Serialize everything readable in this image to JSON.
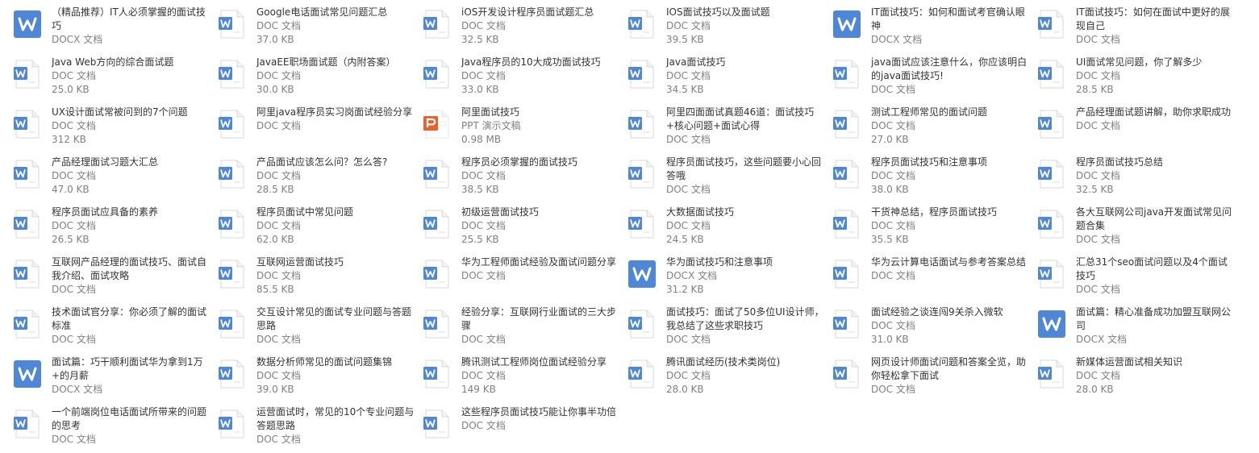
{
  "type_labels": {
    "doc": "DOC 文档",
    "docx": "DOCX 文档",
    "ppt": "PPT 演示文稿"
  },
  "icons": {
    "doc-icon": {
      "fill": "#ffffff",
      "stroke": "#d9d9d9",
      "accent": "#4e86d8"
    },
    "docx-icon": {
      "fill": "#4e86d8",
      "stroke": "#4e86d8",
      "accent": "#ffffff"
    },
    "ppt-icon": {
      "fill": "#ffffff",
      "stroke": "#e8e8e8",
      "accent": "#e8622e"
    }
  },
  "files": [
    {
      "name": "（精品推荐）IT人必须掌握的面试技巧",
      "kind": "docx",
      "size": ""
    },
    {
      "name": "Google电话面试常见问题汇总",
      "kind": "doc",
      "size": "37.0 KB"
    },
    {
      "name": "iOS开发设计程序员面试题汇总",
      "kind": "doc",
      "size": "32.5 KB"
    },
    {
      "name": "IOS面试技巧以及面试题",
      "kind": "doc",
      "size": "39.5 KB"
    },
    {
      "name": "IT面试技巧：如何和面试考官确认眼神",
      "kind": "docx",
      "size": ""
    },
    {
      "name": "IT面试技巧：如何在面试中更好的展现自己",
      "kind": "doc",
      "size": ""
    },
    {
      "name": "Java Web方向的综合面试题",
      "kind": "doc",
      "size": "25.0 KB"
    },
    {
      "name": "JavaEE职场面试题（内附答案）",
      "kind": "doc",
      "size": "30.0 KB"
    },
    {
      "name": "Java程序员的10大成功面试技巧",
      "kind": "doc",
      "size": "33.0 KB"
    },
    {
      "name": "Java面试技巧",
      "kind": "doc",
      "size": "34.5 KB"
    },
    {
      "name": "java面试应该注意什么，你应该明白的java面试技巧!",
      "kind": "doc",
      "size": ""
    },
    {
      "name": "UI面试常见问题，你了解多少",
      "kind": "doc",
      "size": "28.5 KB"
    },
    {
      "name": "UX设计面试常被问到的7个问题",
      "kind": "doc",
      "size": "312 KB"
    },
    {
      "name": "阿里java程序员实习岗面试经验分享",
      "kind": "doc",
      "size": ""
    },
    {
      "name": "阿里面试技巧",
      "kind": "ppt",
      "size": "0.98 MB"
    },
    {
      "name": "阿里四面面试真题46道：面试技巧+核心问题+面试心得",
      "kind": "doc",
      "size": ""
    },
    {
      "name": "测试工程师常见的面试问题",
      "kind": "doc",
      "size": "27.0 KB"
    },
    {
      "name": "产品经理面试题讲解，助你求职成功",
      "kind": "doc",
      "size": ""
    },
    {
      "name": "产品经理面试习题大汇总",
      "kind": "doc",
      "size": "47.0 KB"
    },
    {
      "name": "产品面试应该怎么问？怎么答?",
      "kind": "doc",
      "size": "28.5 KB"
    },
    {
      "name": "程序员必须掌握的面试技巧",
      "kind": "doc",
      "size": "38.5 KB"
    },
    {
      "name": "程序员面试技巧，这些问题要小心回答哦",
      "kind": "doc",
      "size": ""
    },
    {
      "name": "程序员面试技巧和注意事项",
      "kind": "doc",
      "size": "38.0 KB"
    },
    {
      "name": "程序员面试技巧总结",
      "kind": "doc",
      "size": "32.5 KB"
    },
    {
      "name": "程序员面试应具备的素养",
      "kind": "doc",
      "size": "26.5 KB"
    },
    {
      "name": "程序员面试中常见问题",
      "kind": "doc",
      "size": "62.0 KB"
    },
    {
      "name": "初级运营面试技巧",
      "kind": "doc",
      "size": "25.5 KB"
    },
    {
      "name": "大数据面试技巧",
      "kind": "doc",
      "size": "24.5 KB"
    },
    {
      "name": "干货神总结，程序员面试技巧",
      "kind": "doc",
      "size": "35.5 KB"
    },
    {
      "name": "各大互联网公司java开发面试常见问题合集",
      "kind": "doc",
      "size": ""
    },
    {
      "name": "互联网产品经理的面试技巧、面试自我介绍、面试攻略",
      "kind": "doc",
      "size": ""
    },
    {
      "name": "互联网运营面试技巧",
      "kind": "doc",
      "size": "85.5 KB"
    },
    {
      "name": "华为工程师面试经验及面试问题分享",
      "kind": "doc",
      "size": ""
    },
    {
      "name": "华为面试技巧和注意事项",
      "kind": "docx",
      "size": "31.2 KB"
    },
    {
      "name": "华为云计算电话面试与参考答案总结",
      "kind": "doc",
      "size": ""
    },
    {
      "name": "汇总31个seo面试问题以及4个面试技巧",
      "kind": "doc",
      "size": ""
    },
    {
      "name": "技术面试官分享：你必须了解的面试标准",
      "kind": "doc",
      "size": ""
    },
    {
      "name": "交互设计常见的面试专业问题与答题思路",
      "kind": "doc",
      "size": ""
    },
    {
      "name": "经验分享：互联网行业面试的三大步骤",
      "kind": "doc",
      "size": ""
    },
    {
      "name": "面试技巧：面试了50多位UI设计师，我总结了这些求职技巧",
      "kind": "doc",
      "size": ""
    },
    {
      "name": "面试经验之谈连闯9关杀入微软",
      "kind": "doc",
      "size": "31.0 KB"
    },
    {
      "name": "面试篇：精心准备成功加盟互联网公司",
      "kind": "docx",
      "size": ""
    },
    {
      "name": "面试篇：巧干顺利面试华为拿到1万+的月薪",
      "kind": "docx",
      "size": ""
    },
    {
      "name": "数据分析师常见的面试问题集锦",
      "kind": "doc",
      "size": "39.0 KB"
    },
    {
      "name": "腾讯测试工程师岗位面试经验分享",
      "kind": "doc",
      "size": "149 KB"
    },
    {
      "name": "腾讯面试经历(技术类岗位)",
      "kind": "doc",
      "size": "28.0 KB"
    },
    {
      "name": "网页设计师面试问题和答案全览，助你轻松拿下面试",
      "kind": "doc",
      "size": ""
    },
    {
      "name": "新媒体运营面试相关知识",
      "kind": "doc",
      "size": "28.0 KB"
    },
    {
      "name": "一个前端岗位电话面试所带来的问题的思考",
      "kind": "doc",
      "size": ""
    },
    {
      "name": "运营面试时，常见的10个专业问题与答题思路",
      "kind": "doc",
      "size": ""
    },
    {
      "name": "这些程序员面试技巧能让你事半功倍",
      "kind": "doc",
      "size": ""
    }
  ]
}
